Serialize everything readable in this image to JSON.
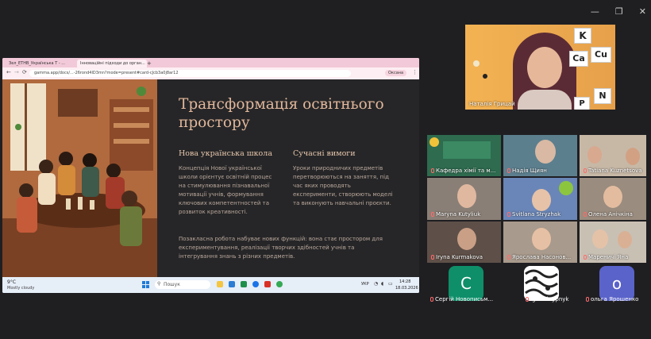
{
  "window": {
    "minimize": "—",
    "restore": "❐",
    "close": "✕"
  },
  "browser": {
    "tabs": [
      {
        "label": "Зел_ЕТНВ_Українська Т - ..."
      },
      {
        "label": "Інноваційні підходи до орган..."
      },
      {
        "label": "+"
      }
    ],
    "nav": {
      "back": "←",
      "forward": "→",
      "reload": "⟳",
      "info": "ⓘ"
    },
    "url": "gamma.app/docs/...-26rond4lD3mn?mode=present#card-cJcb3a0j8ar12",
    "profile": "Оксана",
    "menu": "⋮"
  },
  "slide": {
    "title": "Трансформація освітнього простору",
    "left_heading": "Нова українська школа",
    "left_body": "Концепція Нової української школи орієнтує освітній процес на стимулювання пізнавальної мотивації учнів, формування ключових компетентностей та розвиток креативності.",
    "right_heading": "Сучасні вимоги",
    "right_body": "Уроки природничих предметів перетворюються на заняття, під час яких проводять експерименти, створюють моделі та виконують навчальні проєкти.",
    "bottom_body": "Позакласна робота набуває нових функцій: вона стає простором для експериментування, реалізації творчих здібностей учнів та інтегрування знань з різних предметів."
  },
  "taskbar": {
    "weather_temp": "9°C",
    "weather_desc": "Mostly cloudy",
    "search": "Пошук",
    "lang": "УКР",
    "time": "14:28",
    "date": "18.03.2026"
  },
  "main_speaker": {
    "name": "Наталія Грицай",
    "letters": [
      "K",
      "Ca",
      "Cu",
      "N",
      "P"
    ]
  },
  "participants": [
    {
      "name": "Кафедра хімії та м..."
    },
    {
      "name": "Надія Щиян"
    },
    {
      "name": "Tatiana Kuznetsova"
    },
    {
      "name": "Maryna Kutyliuk"
    },
    {
      "name": "Svitlana Stryzhak"
    },
    {
      "name": "Олена Анічкіна"
    },
    {
      "name": "Iryna Kurmakova"
    },
    {
      "name": "Ярослава Насонов..."
    },
    {
      "name": "Мареничі Яна"
    }
  ],
  "avatars": [
    {
      "initial": "С",
      "name": "Сергій Новописьм...",
      "color": "#0e8f6a"
    },
    {
      "initial": "",
      "name": "Igor Skrypnyk",
      "color": "#ffffff"
    },
    {
      "initial": "о",
      "name": "ольга Ярошенко",
      "color": "#5a63c9"
    }
  ]
}
